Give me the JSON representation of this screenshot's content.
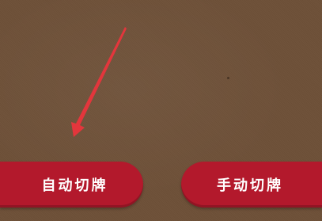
{
  "buttons": {
    "auto_deal": "自动切牌",
    "manual_deal": "手动切牌"
  },
  "colors": {
    "background": "#6e5038",
    "button": "#b3192c",
    "arrow": "#e3363c",
    "text": "#ffffff"
  },
  "icons": {
    "pointer_arrow": "red-arrow-icon"
  }
}
